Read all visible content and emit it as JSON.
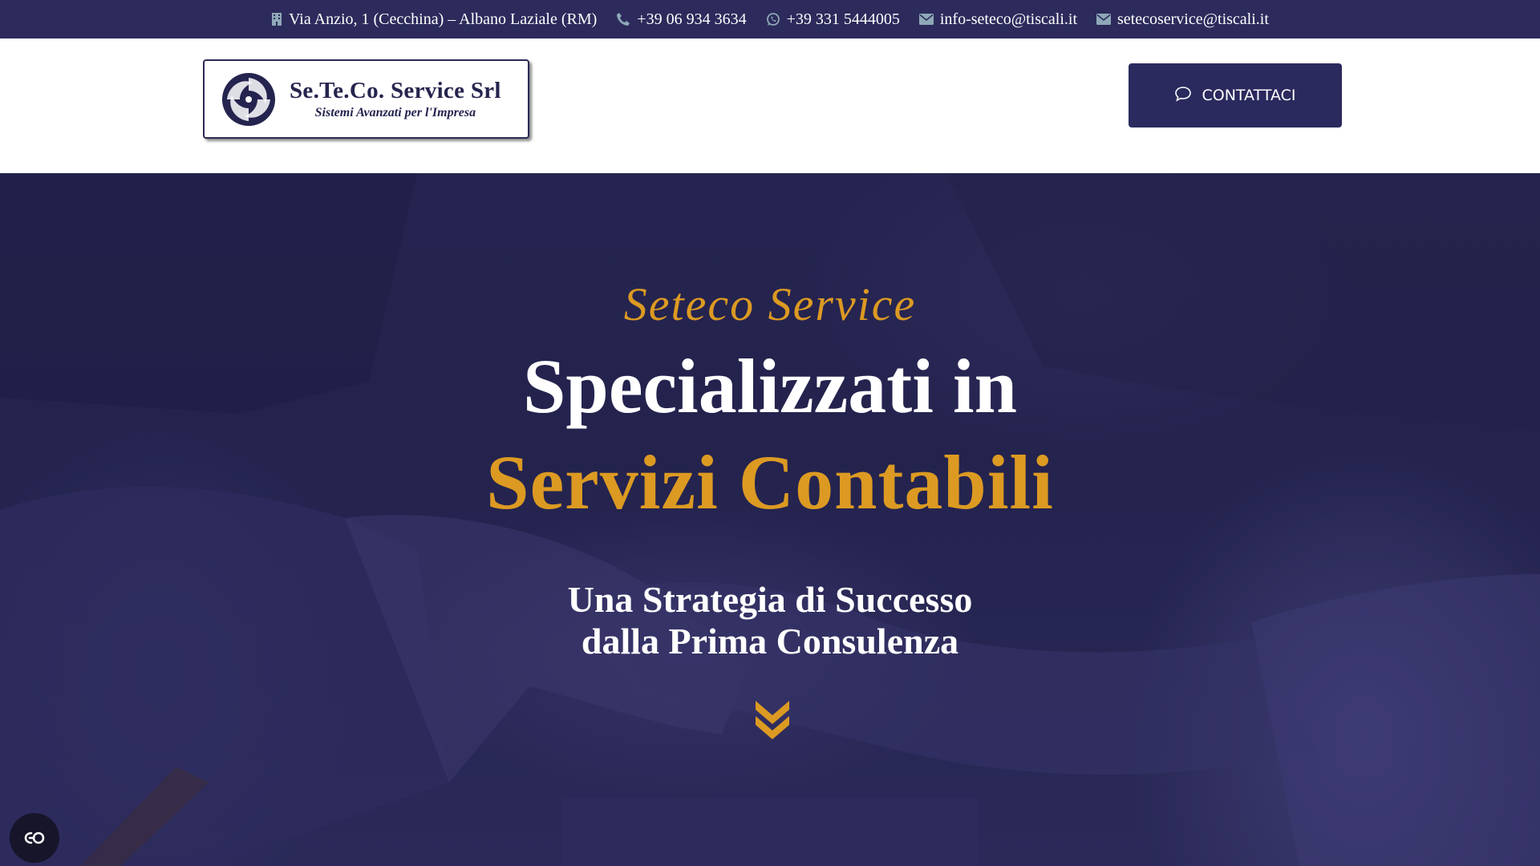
{
  "topbar": {
    "address": "Via Anzio, 1 (Cecchina) – Albano Laziale (RM)",
    "phone": "+39 06 934 3634",
    "whatsapp": "+39 331 5444005",
    "email_1": "info-seteco@tiscali.it",
    "email_2": "setecoservice@tiscali.it",
    "icons": [
      "building-icon",
      "phone-icon",
      "whatsapp-icon",
      "envelope-icon",
      "envelope-icon"
    ]
  },
  "header": {
    "logo_name": "Se.Te.Co. Service Srl",
    "logo_tagline": "Sistemi Avanzati per l'Impresa",
    "contact_button": "CONTATTACI"
  },
  "hero": {
    "kicker": "Seteco Service",
    "title_line_1": "Specializzati in",
    "title_line_2": "Servizi Contabili",
    "subtitle_line_1": "Una Strategia di Successo",
    "subtitle_line_2": "dalla Prima Consulenza"
  },
  "colors": {
    "navy": "#2b2a5e",
    "topbar": "#2c2b5c",
    "gold": "#dc9a22",
    "white": "#ffffff"
  }
}
